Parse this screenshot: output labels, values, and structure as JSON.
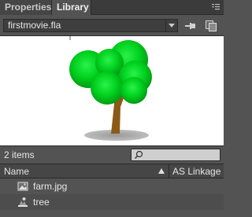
{
  "tabs": [
    {
      "label": "Properties"
    },
    {
      "label": "Library"
    }
  ],
  "active_tab": "Library",
  "document": {
    "selected": "firstmovie.fla"
  },
  "preview": {
    "symbol": "tree"
  },
  "library": {
    "items_count": "2 items",
    "search": {
      "value": ""
    },
    "columns": {
      "name": "Name",
      "linkage": "AS Linkage"
    },
    "items": [
      {
        "name": "farm.jpg",
        "icon": "bitmap-icon"
      },
      {
        "name": "tree",
        "icon": "graphic-symbol-icon"
      }
    ]
  },
  "colors": {
    "panel_bg": "#535353",
    "tab_bar_bg": "#3b3b3b",
    "text": "#e6e6e6",
    "preview_bg": "#ffffff",
    "tree_leaves": "#00c21a",
    "tree_trunk": "#8b5a14"
  }
}
